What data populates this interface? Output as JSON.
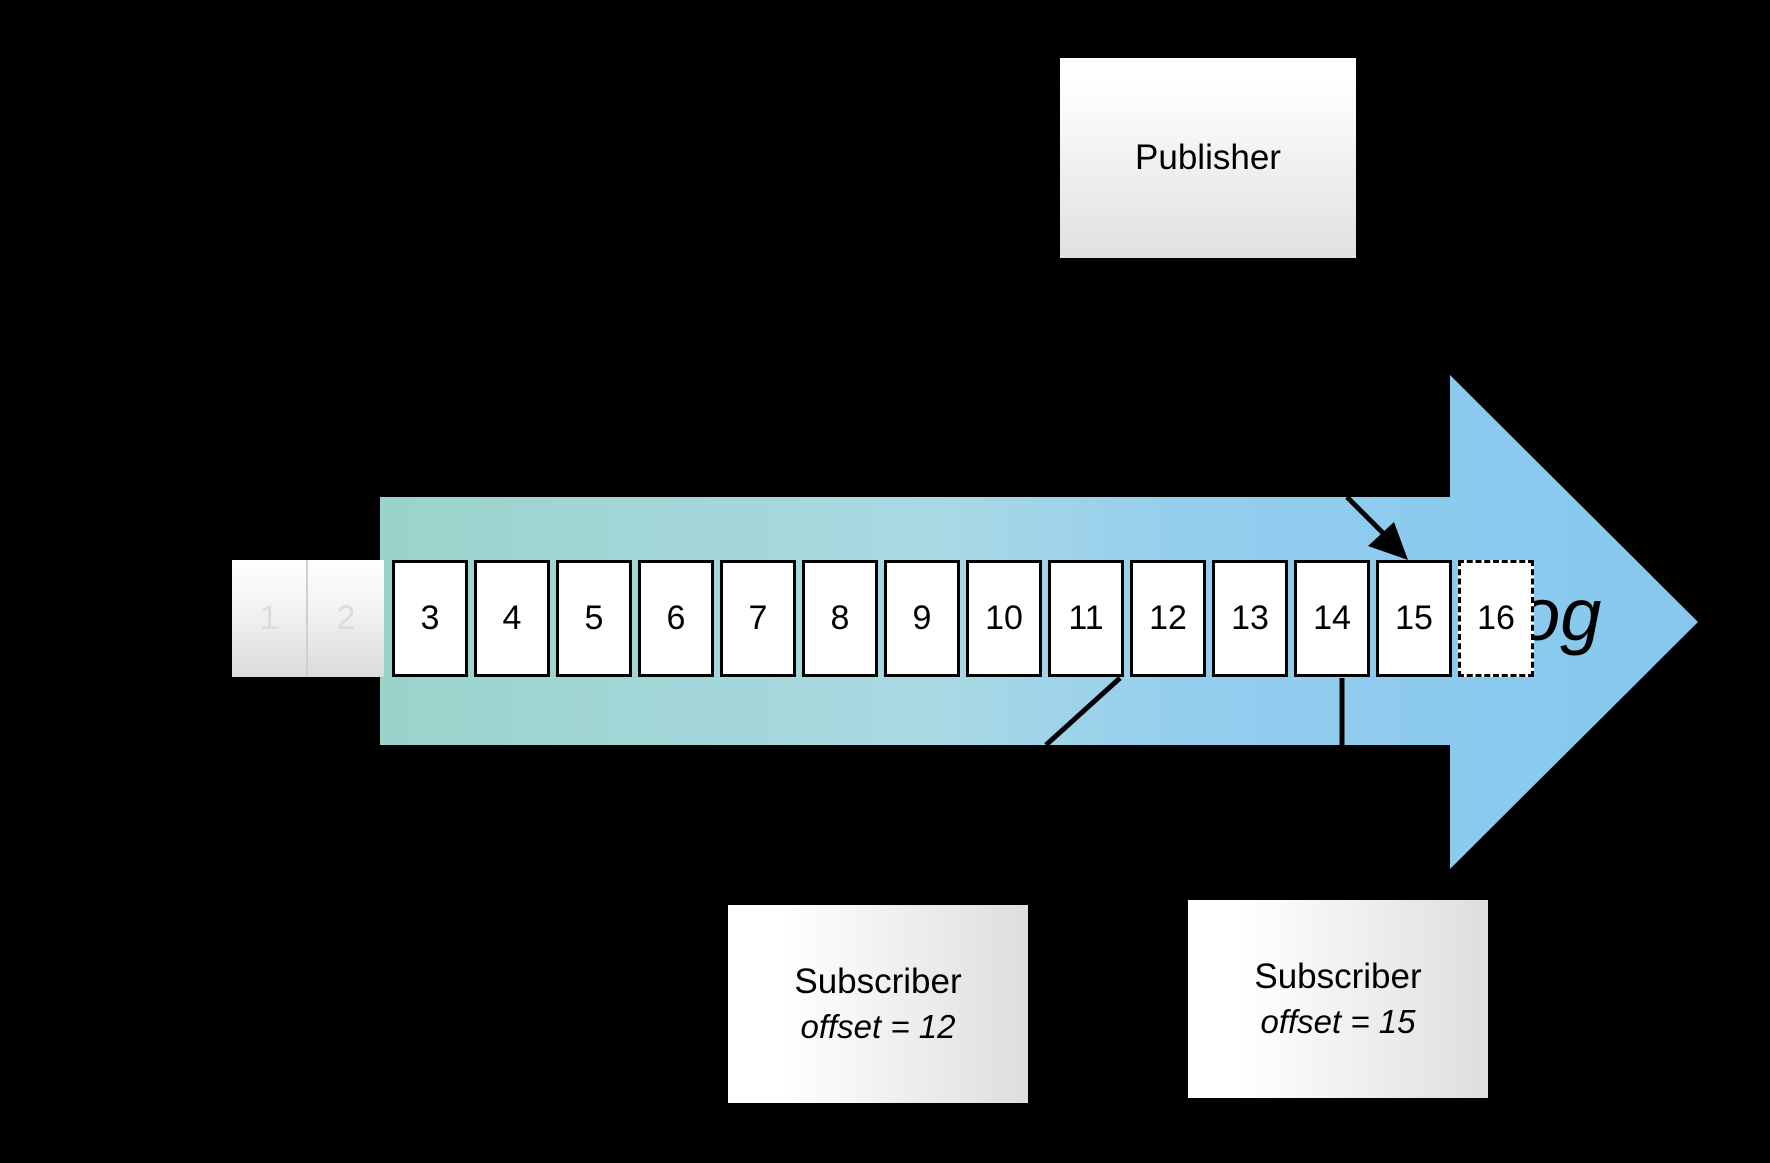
{
  "diagram": {
    "title": "Log",
    "log_label": "Log",
    "publisher": {
      "label": "Publisher"
    },
    "subscribers": [
      {
        "label": "Subscriber",
        "offset_text": "offset = 12",
        "offset": 12
      },
      {
        "label": "Subscriber",
        "offset_text": "offset = 15",
        "offset": 15
      }
    ],
    "cells": [
      {
        "value": "1",
        "state": "faded"
      },
      {
        "value": "2",
        "state": "faded"
      },
      {
        "value": "3",
        "state": "committed"
      },
      {
        "value": "4",
        "state": "committed"
      },
      {
        "value": "5",
        "state": "committed"
      },
      {
        "value": "6",
        "state": "committed"
      },
      {
        "value": "7",
        "state": "committed"
      },
      {
        "value": "8",
        "state": "committed"
      },
      {
        "value": "9",
        "state": "committed"
      },
      {
        "value": "10",
        "state": "committed"
      },
      {
        "value": "11",
        "state": "committed"
      },
      {
        "value": "12",
        "state": "committed"
      },
      {
        "value": "13",
        "state": "committed"
      },
      {
        "value": "14",
        "state": "committed"
      },
      {
        "value": "15",
        "state": "committed"
      },
      {
        "value": "16",
        "state": "pending"
      }
    ],
    "colors": {
      "background": "#000000",
      "arrow_start": "#9ad3cb",
      "arrow_end": "#85c8ee",
      "cell_fill": "#ffffff",
      "cell_border": "#000000",
      "faded_text": "#dcdcdc",
      "box_fill_light": "#ffffff",
      "box_fill_dark": "#dedede"
    },
    "annotations": {
      "publisher_to_cell_arrow": "arrow from Publisher to cell 16",
      "subscriber_1_pointer": "line from subscriber offset = 12 to cell 12",
      "subscriber_2_pointer": "line from subscriber offset = 15 to cell 15"
    }
  }
}
